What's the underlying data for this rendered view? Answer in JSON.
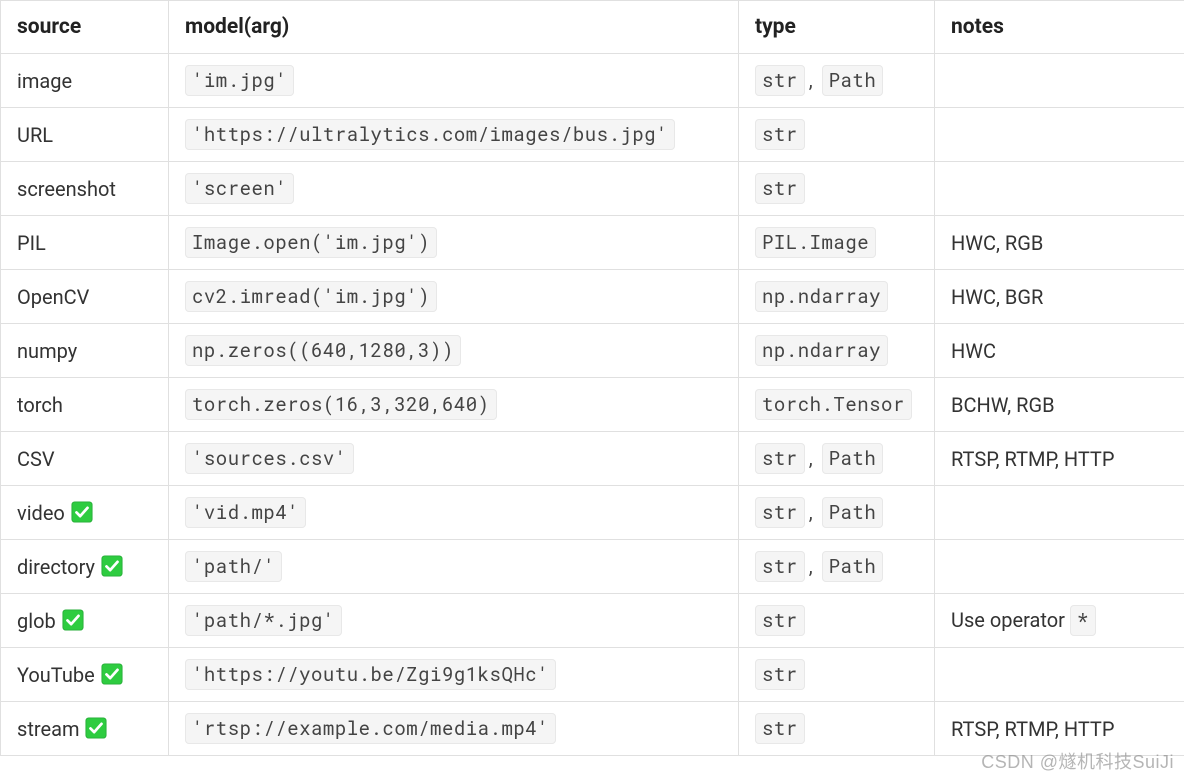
{
  "headers": {
    "source": "source",
    "model": "model(arg)",
    "type": "type",
    "notes": "notes"
  },
  "rows": [
    {
      "source": "image",
      "check": false,
      "model": [
        "'im.jpg'"
      ],
      "type": [
        "str",
        "Path"
      ],
      "notes_text": "",
      "notes_code": []
    },
    {
      "source": "URL",
      "check": false,
      "model": [
        "'https://ultralytics.com/images/bus.jpg'"
      ],
      "type": [
        "str"
      ],
      "notes_text": "",
      "notes_code": []
    },
    {
      "source": "screenshot",
      "check": false,
      "model": [
        "'screen'"
      ],
      "type": [
        "str"
      ],
      "notes_text": "",
      "notes_code": []
    },
    {
      "source": "PIL",
      "check": false,
      "model": [
        "Image.open('im.jpg')"
      ],
      "type": [
        "PIL.Image"
      ],
      "notes_text": "HWC, RGB",
      "notes_code": []
    },
    {
      "source": "OpenCV",
      "check": false,
      "model": [
        "cv2.imread('im.jpg')"
      ],
      "type": [
        "np.ndarray"
      ],
      "notes_text": "HWC, BGR",
      "notes_code": []
    },
    {
      "source": "numpy",
      "check": false,
      "model": [
        "np.zeros((640,1280,3))"
      ],
      "type": [
        "np.ndarray"
      ],
      "notes_text": "HWC",
      "notes_code": []
    },
    {
      "source": "torch",
      "check": false,
      "model": [
        "torch.zeros(16,3,320,640)"
      ],
      "type": [
        "torch.Tensor"
      ],
      "notes_text": "BCHW, RGB",
      "notes_code": []
    },
    {
      "source": "CSV",
      "check": false,
      "model": [
        "'sources.csv'"
      ],
      "type": [
        "str",
        "Path"
      ],
      "notes_text": "RTSP, RTMP, HTTP",
      "notes_code": []
    },
    {
      "source": "video",
      "check": true,
      "model": [
        "'vid.mp4'"
      ],
      "type": [
        "str",
        "Path"
      ],
      "notes_text": "",
      "notes_code": []
    },
    {
      "source": "directory",
      "check": true,
      "model": [
        "'path/'"
      ],
      "type": [
        "str",
        "Path"
      ],
      "notes_text": "",
      "notes_code": []
    },
    {
      "source": "glob",
      "check": true,
      "model": [
        "'path/*.jpg'"
      ],
      "type": [
        "str"
      ],
      "notes_text": "Use operator ",
      "notes_code": [
        "*"
      ]
    },
    {
      "source": "YouTube",
      "check": true,
      "model": [
        "'https://youtu.be/Zgi9g1ksQHc'"
      ],
      "type": [
        "str"
      ],
      "notes_text": "",
      "notes_code": []
    },
    {
      "source": "stream",
      "check": true,
      "model": [
        "'rtsp://example.com/media.mp4'"
      ],
      "type": [
        "str"
      ],
      "notes_text": "RTSP, RTMP, HTTP",
      "notes_code": []
    }
  ],
  "watermark": "CSDN @燧机科技SuiJi"
}
